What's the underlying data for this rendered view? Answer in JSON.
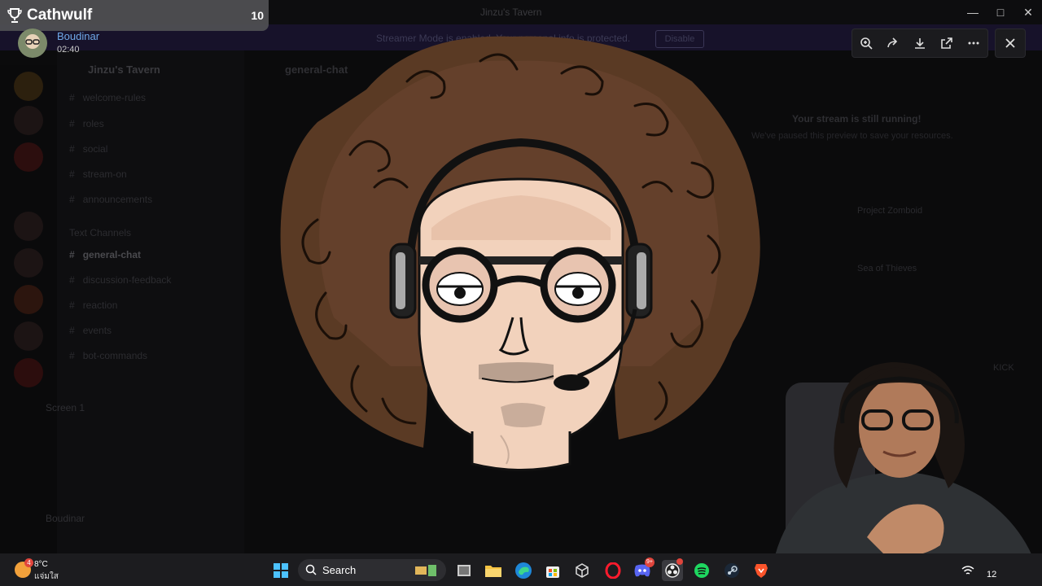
{
  "background_app": {
    "window_title": "Jinzu's Tavern",
    "banner_text": "Streamer Mode is enabled. Your personal info is protected.",
    "banner_button": "Disable",
    "server_name": "Jinzu's Tavern",
    "channels": [
      {
        "label": "welcome-rules",
        "active": false
      },
      {
        "label": "roles",
        "active": false
      },
      {
        "label": "social",
        "active": false
      },
      {
        "label": "stream-on",
        "active": false
      },
      {
        "label": "announcements",
        "active": false
      },
      {
        "label": "general-chat",
        "active": true
      },
      {
        "label": "discussion-feedback",
        "active": false
      },
      {
        "label": "reaction",
        "active": false
      },
      {
        "label": "events",
        "active": false
      },
      {
        "label": "bot-commands",
        "active": false
      }
    ],
    "channel_category": "Text Channels",
    "screen_panel_title": "Screen 1",
    "user_panel_name": "Boudinar",
    "chat_header": "general-chat",
    "stream_status_title": "Your stream is still running!",
    "stream_status_sub": "We've paused this preview to save your resources.",
    "right_items": [
      "Project Zomboid",
      "Sea of Thieves"
    ],
    "right_kick_label": "KICK"
  },
  "overlay": {
    "achievement_name": "Cathwulf",
    "achievement_count": "10",
    "caller_name": "Boudinar",
    "caller_time": "02:40"
  },
  "viewer_toolbar": {
    "tools": [
      "zoom-in-icon",
      "forward-icon",
      "download-icon",
      "open-external-icon",
      "more-icon"
    ],
    "close": "close-icon"
  },
  "taskbar": {
    "weather_temp": "8°C",
    "weather_desc": "แจ่มใส",
    "weather_badge": "4",
    "search_placeholder": "Search",
    "discord_badge": "9+",
    "tray_time": "12"
  },
  "colors": {
    "banner": "#17122a",
    "hair": "#5a3a24",
    "skin": "#f2d2bc",
    "taskbar": "#1c1c1f"
  }
}
